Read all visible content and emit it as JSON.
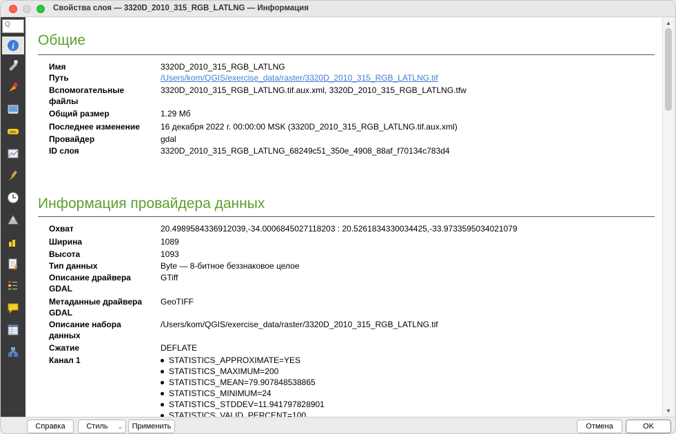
{
  "window": {
    "title": "Свойства слоя — 3320D_2010_315_RGB_LATLNG — Информация"
  },
  "sidebar": {
    "search_placeholder": "Q",
    "icons": [
      "info-icon",
      "source-icon",
      "symbology-icon",
      "transparency-icon",
      "labels-icon",
      "histogram-icon",
      "rendering-icon",
      "temporal-icon",
      "pyramids-icon",
      "elevation-icon",
      "metadata-icon",
      "legend-icon",
      "display-icon",
      "attribute-table-icon",
      "server-icon"
    ]
  },
  "general": {
    "heading": "Общие",
    "rows": [
      {
        "key": "Имя",
        "value": "3320D_2010_315_RGB_LATLNG"
      },
      {
        "key": "Путь",
        "value": "/Users/kom/QGIS/exercise_data/raster/3320D_2010_315_RGB_LATLNG.tif"
      },
      {
        "key": "Вспомогательные",
        "key2": "файлы",
        "value": "3320D_2010_315_RGB_LATLNG.tif.aux.xml, 3320D_2010_315_RGB_LATLNG.tfw"
      },
      {
        "key": "Общий размер",
        "value": "1.29 Мб"
      },
      {
        "key": "Последнее изменение",
        "value": "16 декабря 2022 г. 00:00:00 MSK (3320D_2010_315_RGB_LATLNG.tif.aux.xml)"
      },
      {
        "key": "Провайдер",
        "value": "gdal"
      },
      {
        "key": "ID слоя",
        "value": "3320D_2010_315_RGB_LATLNG_68249c51_350e_4908_88af_f70134c783d4"
      }
    ]
  },
  "provider": {
    "heading": "Информация провайдера данных",
    "rows": [
      {
        "key": "Охват",
        "value": "20.4989584336912039,-34.0006845027118203 : 20.5261834330034425,-33.9733595034021079"
      },
      {
        "key": "Ширина",
        "value": "1089"
      },
      {
        "key": "Высота",
        "value": "1093"
      },
      {
        "key": "Тип данных",
        "value": "Byte — 8-битное беззнаковое целое"
      },
      {
        "key": "Описание драйвера",
        "key2": "GDAL",
        "value": "GTiff"
      },
      {
        "key": "Метаданные драйвера",
        "key2": "GDAL",
        "value": "GeoTIFF"
      },
      {
        "key": "Описание набора",
        "key2": "данных",
        "value": "/Users/kom/QGIS/exercise_data/raster/3320D_2010_315_RGB_LATLNG.tif"
      },
      {
        "key": "Сжатие",
        "value": "DEFLATE"
      },
      {
        "key": "Канал 1",
        "value": ""
      }
    ],
    "band1": [
      "STATISTICS_APPROXIMATE=YES",
      "STATISTICS_MAXIMUM=200",
      "STATISTICS_MEAN=79.907848538865",
      "STATISTICS_MINIMUM=24",
      "STATISTICS_STDDEV=11.941797828901",
      "STATISTICS_VALID_PERCENT=100"
    ]
  },
  "buttons": {
    "help": "Справка",
    "style": "Стиль",
    "apply": "Применить",
    "cancel": "Отмена",
    "ok": "OK"
  }
}
